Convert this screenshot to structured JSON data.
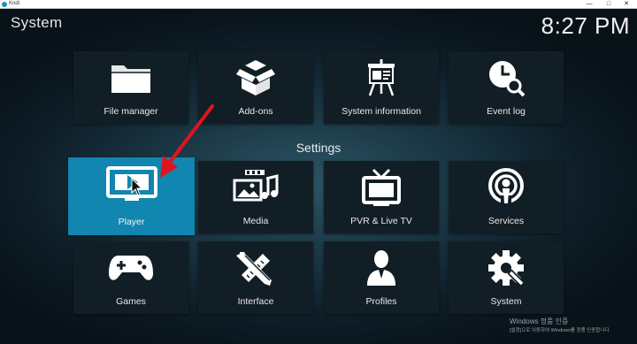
{
  "window": {
    "title": "Kodi",
    "minimize": "—",
    "maximize": "□",
    "close": "✕"
  },
  "header": {
    "title": "System",
    "clock": "8:27 PM"
  },
  "section_label": "Settings",
  "tiles": [
    {
      "label": "File manager",
      "icon": "folder-icon"
    },
    {
      "label": "Add-ons",
      "icon": "open-box-icon"
    },
    {
      "label": "System information",
      "icon": "presentation-board-icon"
    },
    {
      "label": "Event log",
      "icon": "clock-search-icon"
    },
    {
      "label": "Player",
      "icon": "monitor-play-icon",
      "active": true
    },
    {
      "label": "Media",
      "icon": "media-collage-icon"
    },
    {
      "label": "PVR & Live TV",
      "icon": "tv-antenna-icon"
    },
    {
      "label": "Services",
      "icon": "podcast-icon"
    },
    {
      "label": "Games",
      "icon": "gamepad-icon"
    },
    {
      "label": "Interface",
      "icon": "pencil-ruler-icon"
    },
    {
      "label": "Profiles",
      "icon": "user-silhouette-icon"
    },
    {
      "label": "System",
      "icon": "gear-wrench-icon"
    }
  ],
  "watermark": {
    "line1": "Windows 정품 인증",
    "line2": "[설정]으로 이동하여 Windows를 정품 인증합니다."
  },
  "colors": {
    "accent": "#1086b0",
    "tile": "#121e25",
    "annotation_arrow": "#e0141e"
  }
}
